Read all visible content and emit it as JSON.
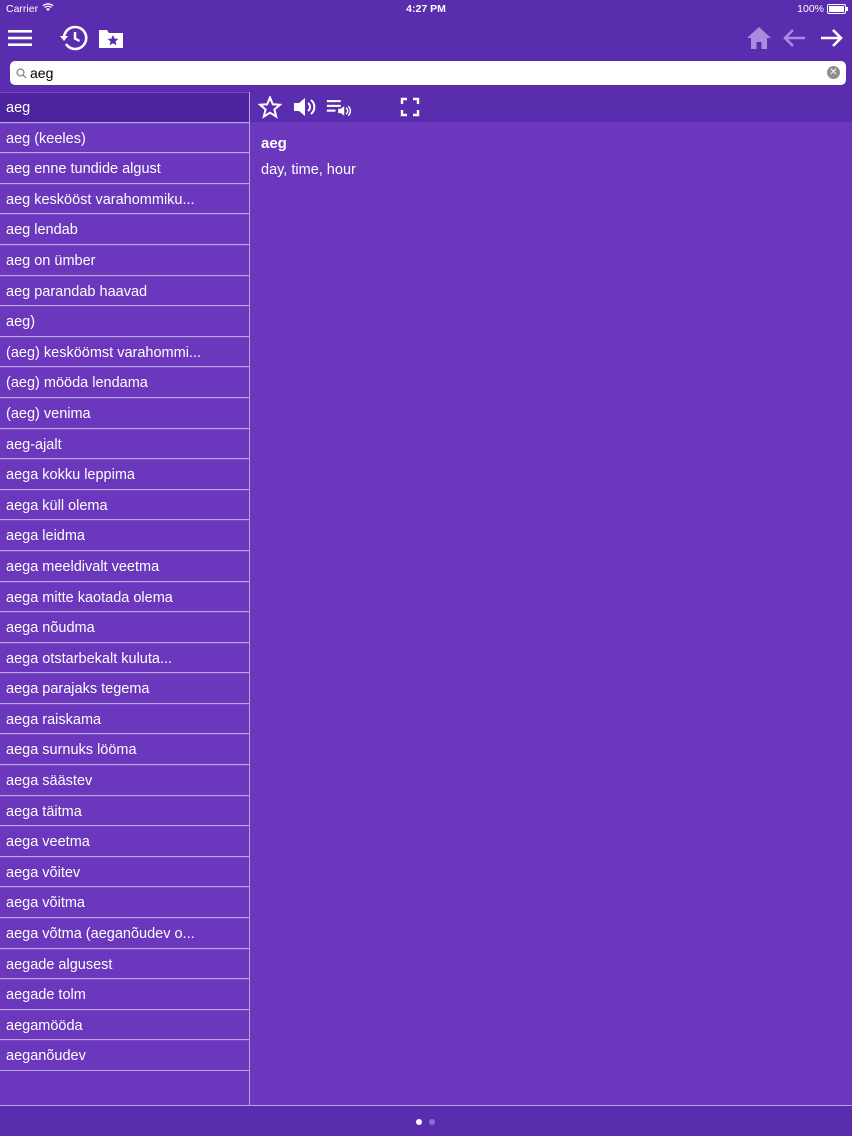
{
  "status": {
    "carrier": "Carrier",
    "time": "4:27 PM",
    "battery": "100%"
  },
  "toolbar": {
    "icons": [
      "menu-icon",
      "history-icon",
      "favorites-folder-icon",
      "home-icon",
      "back-arrow-icon",
      "forward-arrow-icon"
    ]
  },
  "search": {
    "value": "aeg",
    "placeholder": ""
  },
  "word_list": [
    "aeg",
    "aeg (keeles)",
    "aeg enne tundide algust",
    "aeg keskööst varahommiku...",
    "aeg lendab",
    "aeg on ümber",
    "aeg parandab haavad",
    "aeg)",
    "(aeg) kesköömst varahommi...",
    "(aeg) mööda lendama",
    "(aeg) venima",
    "aeg-ajalt",
    "aega kokku leppima",
    "aega küll olema",
    "aega leidma",
    "aega meeldivalt veetma",
    "aega mitte kaotada olema",
    "aega nõudma",
    "aega otstarbekalt kuluta...",
    "aega parajaks tegema",
    "aega raiskama",
    "aega surnuks lööma",
    "aega säästev",
    "aega täitma",
    "aega veetma",
    "aega võitev",
    "aega võitma",
    "aega võtma (aeganõudev o...",
    "aegade algusest",
    "aegade tolm",
    "aegamööda",
    "aeganõudev"
  ],
  "detail": {
    "headword": "aeg",
    "translation": "day, time, hour",
    "icons": [
      "star-icon",
      "speaker-icon",
      "playlist-speaker-icon",
      "fullscreen-icon"
    ]
  },
  "pager": {
    "pages": 2,
    "current": 1
  }
}
